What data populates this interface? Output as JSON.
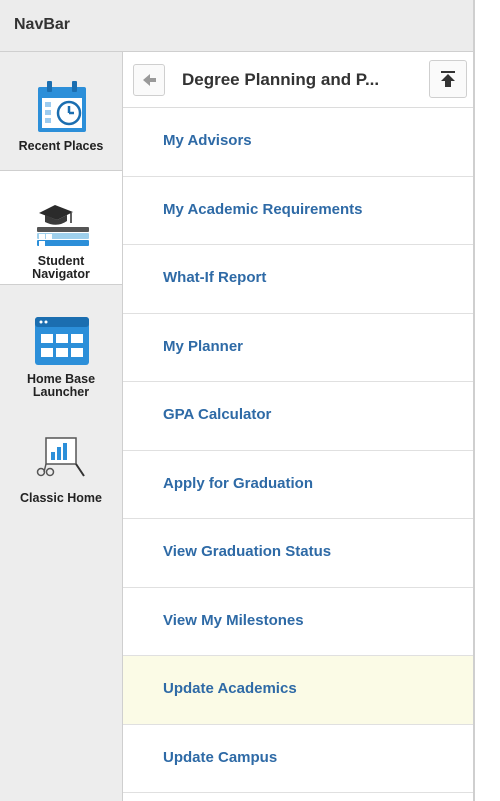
{
  "navbar": {
    "title": "NavBar"
  },
  "sidebar": {
    "items": [
      {
        "label": "Recent Places",
        "icon": "calendar-clock-icon"
      },
      {
        "label_line1": "Student",
        "label_line2": "Navigator",
        "icon": "graduation-cap-books-icon",
        "active": true
      },
      {
        "label_line1": "Home Base",
        "label_line2": "Launcher",
        "icon": "grid-window-icon"
      },
      {
        "label": "Classic Home",
        "icon": "chart-easel-icon"
      }
    ]
  },
  "content": {
    "header_title": "Degree Planning and P...",
    "menu": [
      "My Advisors",
      "My Academic Requirements",
      "What-If Report",
      "My Planner",
      "GPA Calculator",
      "Apply for Graduation",
      "View Graduation Status",
      "View My Milestones",
      "Update Academics",
      "Update Campus"
    ]
  },
  "colors": {
    "link": "#2e6aa6",
    "icon_blue": "#2c8fd9",
    "highlight": "#fbfbe6"
  }
}
